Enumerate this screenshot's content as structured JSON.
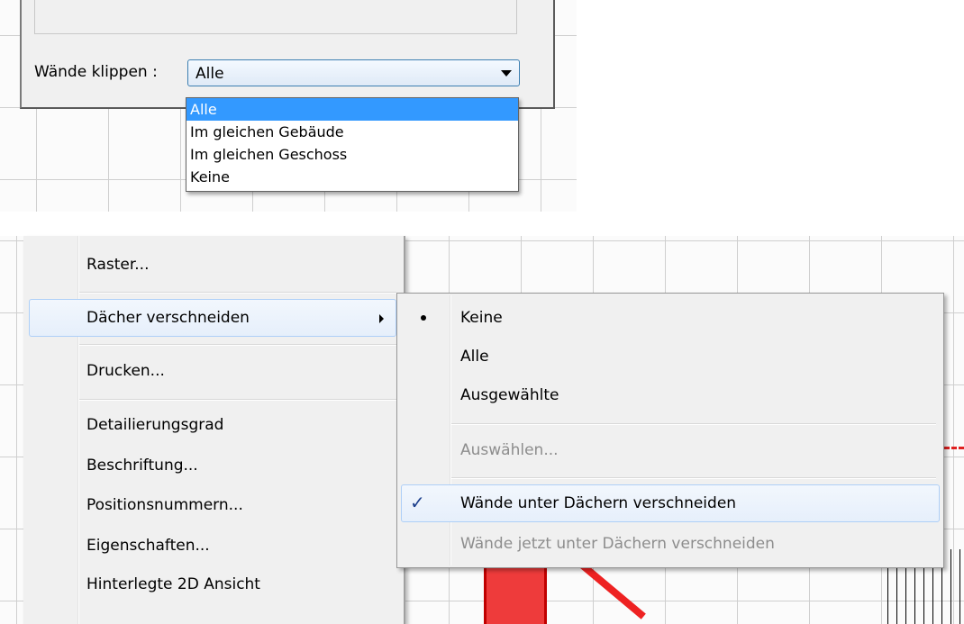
{
  "dialog": {
    "label": "Wände klippen :",
    "combo_value": "Alle",
    "options": [
      "Alle",
      "Im gleichen Gebäude",
      "Im gleichen Geschoss",
      "Keine"
    ],
    "selected_index": 0
  },
  "menu": {
    "items": {
      "raster": "Raster...",
      "daecher": "Dächer verschneiden",
      "drucken": "Drucken...",
      "detail": "Detailierungsgrad",
      "beschriftung": "Beschriftung...",
      "positionsnummern": "Positionsnummern...",
      "eigenschaften": "Eigenschaften...",
      "hinterlegte": "Hinterlegte 2D Ansicht"
    }
  },
  "submenu": {
    "keine": "Keine",
    "alle": "Alle",
    "ausgewaehlte": "Ausgewählte",
    "auswaehlen": "Auswählen...",
    "waende_unter": "Wände unter Dächern verschneiden",
    "waende_jetzt": "Wände jetzt unter Dächern verschneiden",
    "check_glyph": "✓"
  },
  "colors": {
    "selection": "#3399ff",
    "menu_highlight": "#e6effb",
    "disabled_text": "#8d8d8d",
    "canvas_red": "#ee3b3b"
  }
}
